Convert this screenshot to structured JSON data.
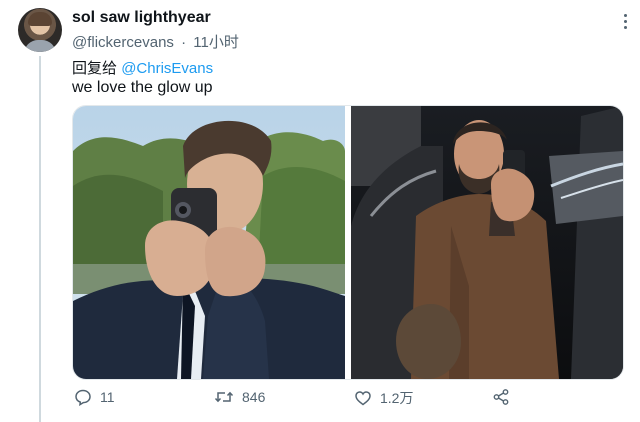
{
  "tweet": {
    "display_name": "sol saw lighthyear",
    "handle": "@flickercevans",
    "separator": "·",
    "time": "11小时",
    "reply_prefix": "回复给",
    "reply_mention": "@ChrisEvans",
    "text": "we love the glow up"
  },
  "media": {
    "images": [
      {
        "icon": "photo-mirror-selfie-suit"
      },
      {
        "icon": "photo-mirror-selfie-leather-jacket"
      }
    ]
  },
  "actions": {
    "reply_count": "11",
    "retweet_count": "846",
    "like_count": "1.2万",
    "share_icon": "share-icon"
  },
  "colors": {
    "accent": "#1d9bf0",
    "text_primary": "#0f1419",
    "text_secondary": "#536471",
    "thread_line": "#cfd9de"
  }
}
